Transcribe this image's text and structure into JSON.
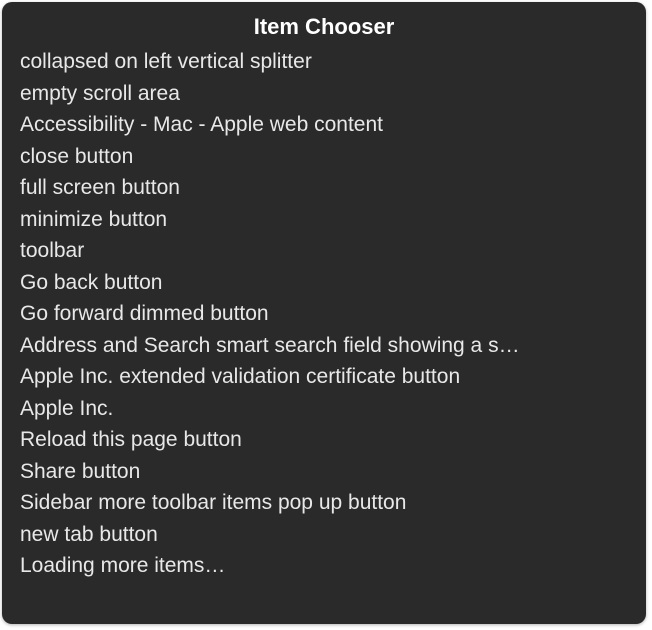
{
  "title": "Item Chooser",
  "items": [
    "collapsed on left vertical splitter",
    "empty scroll area",
    "Accessibility - Mac - Apple web content",
    "close button",
    "full screen button",
    "minimize button",
    "toolbar",
    "Go back button",
    "Go forward dimmed button",
    "Address and Search smart search field showing a s…",
    "Apple Inc. extended validation certificate button",
    "Apple Inc.",
    "Reload this page button",
    "Share button",
    "Sidebar more toolbar items pop up button",
    "new tab button",
    "Loading more items…"
  ]
}
